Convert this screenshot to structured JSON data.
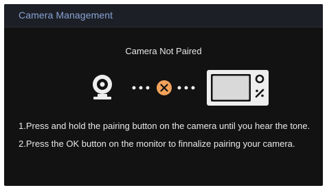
{
  "header": {
    "title": "Camera Management"
  },
  "status": {
    "title": "Camera Not Paired"
  },
  "icons": {
    "camera": "camera-icon",
    "link_failed": "close-x-icon",
    "monitor": "monitor-icon",
    "accent_color": "#f2a25a"
  },
  "instructions": {
    "step1": "1.Press and hold the pairing button on the camera until you hear the tone.",
    "step2": "2.Press the OK button on the monitor to finnalize pairing your camera."
  }
}
